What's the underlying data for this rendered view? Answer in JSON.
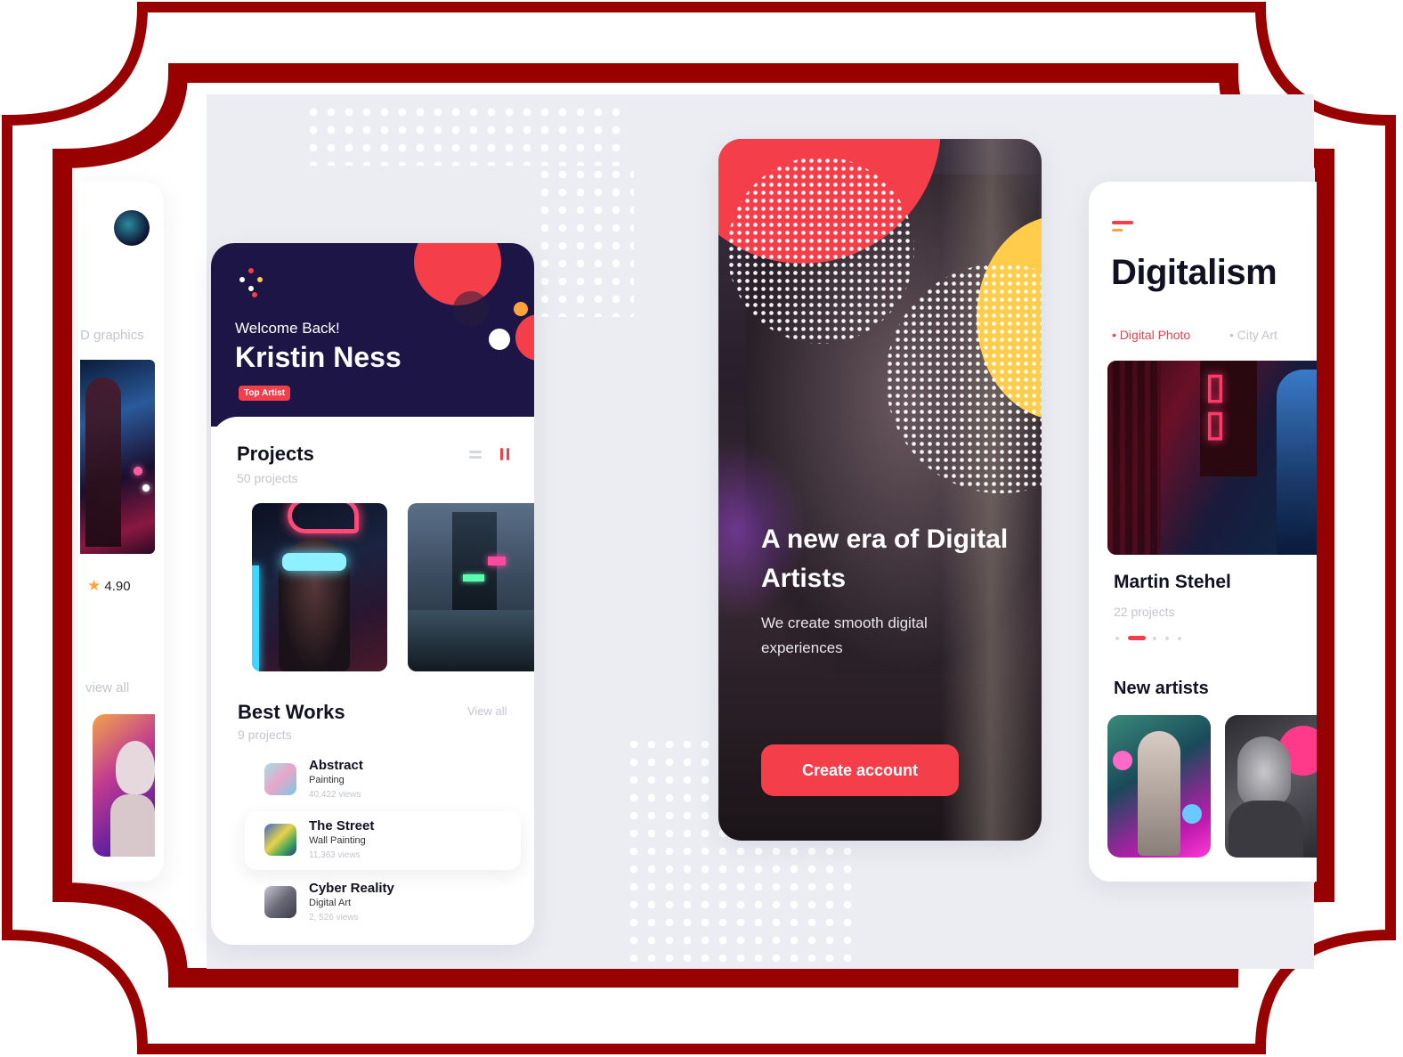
{
  "frame": {
    "border_color": "#990000",
    "background": "#ffffff",
    "canvas": "#ecedf2"
  },
  "colors": {
    "accent": "#f43f4a",
    "navy": "#1c1545",
    "yellow": "#ffcd4a",
    "orange": "#ffa43a"
  },
  "left_card": {
    "category_label": "D graphics",
    "rating": "4.90",
    "star_icon": "star-icon",
    "view_all": "view all"
  },
  "profile_card": {
    "welcome": "Welcome Back!",
    "name": "Kristin Ness",
    "badge": "Top Artist",
    "projects_title": "Projects",
    "projects_count": "50 projects",
    "best_works_title": "Best Works",
    "best_works_count": "9 projects",
    "view_all": "View all",
    "works": [
      {
        "title": "Abstract",
        "subtitle": "Painting",
        "views": "40,422 views"
      },
      {
        "title": "The Street",
        "subtitle": "Wall Painting",
        "views": "11,363 views"
      },
      {
        "title": "Cyber Reality",
        "subtitle": "Digital Art",
        "views": "2, 526 views"
      }
    ]
  },
  "hero_card": {
    "headline": "A new era of Digital Artists",
    "headline_line1": "A new era of Digital",
    "headline_line2": "Artists",
    "subtitle_line1": "We create smooth digital",
    "subtitle_line2": "experiences",
    "cta": "Create account"
  },
  "right_card": {
    "title": "Digitalism",
    "tabs": [
      {
        "label": "Digital Photo",
        "active": true
      },
      {
        "label": "City Art",
        "active": false
      }
    ],
    "artist_name": "Martin Stehel",
    "artist_projects": "22 projects",
    "pager_active_index": 1,
    "pager_count": 5,
    "new_artists_title": "New artists"
  }
}
